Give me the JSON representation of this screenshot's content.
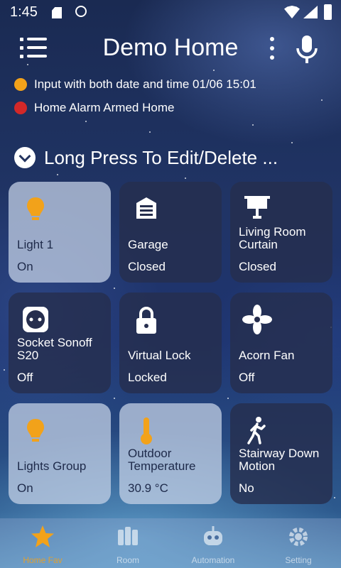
{
  "status_bar": {
    "time": "1:45"
  },
  "app_bar": {
    "title": "Demo Home"
  },
  "notifications": [
    {
      "text": "Input with both date and time 01/06 15:01",
      "icon": "clock-icon",
      "color": "#f2a21a"
    },
    {
      "text": "Home Alarm Armed Home",
      "icon": "shield-icon",
      "color": "#d32828"
    }
  ],
  "section": {
    "title": "Long Press To Edit/Delete ..."
  },
  "tiles": [
    {
      "name": "Light 1",
      "state": "On",
      "icon": "bulb-icon",
      "active": true
    },
    {
      "name": "Garage",
      "state": "Closed",
      "icon": "garage-icon",
      "active": false
    },
    {
      "name": "Living Room Curtain",
      "state": "Closed",
      "icon": "curtain-icon",
      "active": false
    },
    {
      "name": "Socket Sonoff S20",
      "state": "Off",
      "icon": "socket-icon",
      "active": false
    },
    {
      "name": "Virtual Lock",
      "state": "Locked",
      "icon": "lock-icon",
      "active": false
    },
    {
      "name": "Acorn Fan",
      "state": "Off",
      "icon": "fan-icon",
      "active": false
    },
    {
      "name": "Lights Group",
      "state": "On",
      "icon": "bulb-icon",
      "active": true
    },
    {
      "name": "Outdoor Temperature",
      "state": "30.9 °C",
      "icon": "thermometer-icon",
      "active": true
    },
    {
      "name": "Stairway Down Motion",
      "state": "No",
      "icon": "walking-person-icon",
      "active": false
    }
  ],
  "bottom_nav": [
    {
      "label": "Home Fav",
      "icon": "star-icon",
      "active": true
    },
    {
      "label": "Room",
      "icon": "room-icon",
      "active": false
    },
    {
      "label": "Automation",
      "icon": "robot-icon",
      "active": false
    },
    {
      "label": "Setting",
      "icon": "gear-icon",
      "active": false
    }
  ],
  "colors": {
    "accent": "#f2a21a",
    "tile_dark": "#262e4e",
    "tile_light": "#c3d0e6",
    "alarm": "#d32828"
  }
}
